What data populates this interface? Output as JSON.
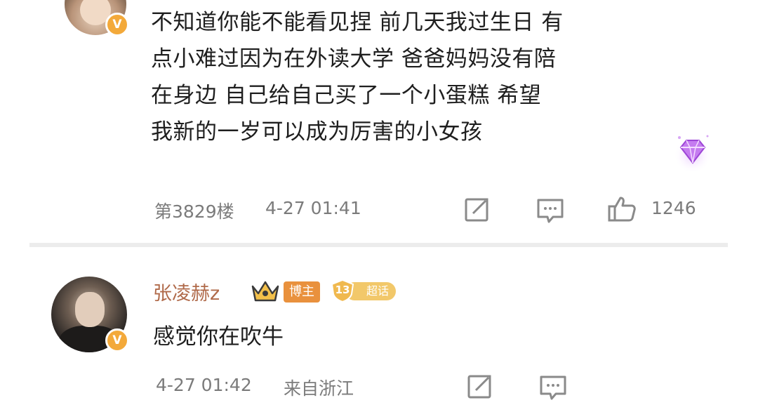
{
  "comments": [
    {
      "text_lines": [
        "不知道你能不能看见捏 前几天我过生日 有",
        "点小难过因为在外读大学 爸爸妈妈没有陪",
        "在身边  自己给自己买了一个小蛋糕 希望",
        "我新的一岁可以成为厉害的小女孩"
      ],
      "floor": "第3829楼",
      "time": "4-27 01:41",
      "likes": "1246",
      "verified_badge": "V",
      "icons": [
        "share-icon",
        "comment-icon",
        "thumbs-up-icon",
        "diamond-gem-icon"
      ]
    },
    {
      "username": "张凌赫z",
      "owner_badge": "博主",
      "fan_level": "13",
      "fan_badge_text": "超话",
      "text": "感觉你在吹牛",
      "time": "4-27 01:42",
      "location": "来自浙江",
      "verified_badge": "V",
      "icons": [
        "crown-icon",
        "share-icon",
        "comment-icon"
      ]
    }
  ],
  "colors": {
    "username": "#b06a4a",
    "meta_text": "#7b7b7b",
    "verified_badge": "#f3a93a",
    "owner_badge": "#e9913d",
    "fan_badge": "#f2c86a",
    "gem": "#b866e8"
  }
}
